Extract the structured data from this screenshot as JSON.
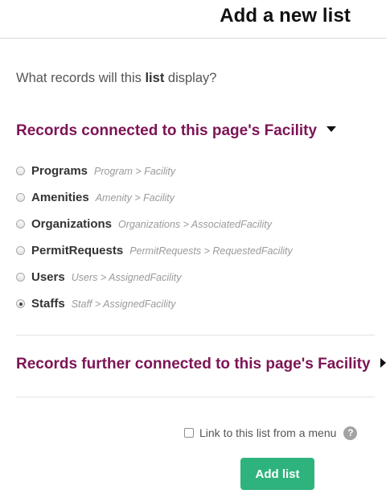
{
  "header": {
    "title": "Add a new list"
  },
  "question": {
    "prefix": "What records will this ",
    "emphasis": "list",
    "suffix": " display?"
  },
  "section_connected": {
    "title": "Records connected to this page's Facility",
    "expanded": true,
    "options": [
      {
        "label": "Programs",
        "path": "Program > Facility",
        "selected": false
      },
      {
        "label": "Amenities",
        "path": "Amenity > Facility",
        "selected": false
      },
      {
        "label": "Organizations",
        "path": "Organizations > AssociatedFacility",
        "selected": false
      },
      {
        "label": "PermitRequests",
        "path": "PermitRequests > RequestedFacility",
        "selected": false
      },
      {
        "label": "Users",
        "path": "Users > AssignedFacility",
        "selected": false
      },
      {
        "label": "Staffs",
        "path": "Staff > AssignedFacility",
        "selected": true
      }
    ]
  },
  "section_further": {
    "title": "Records further connected to this page's Facility",
    "expanded": false
  },
  "menu_link": {
    "label": "Link to this list from a menu",
    "checked": false,
    "help_symbol": "?"
  },
  "actions": {
    "add_label": "Add list"
  },
  "colors": {
    "section_title": "#7d1455",
    "primary_button": "#2fb37c",
    "help_icon": "#a3a3a3"
  }
}
